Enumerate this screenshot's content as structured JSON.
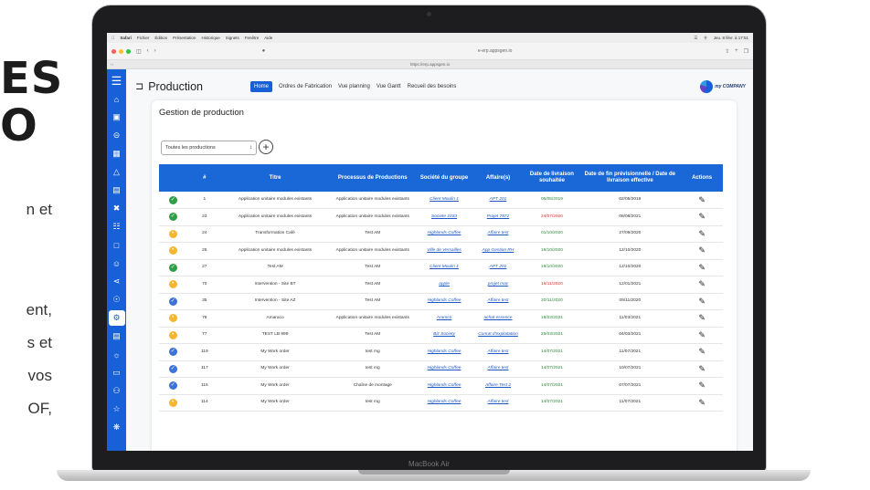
{
  "hero": {
    "line1": "ES",
    "line2": "O",
    "frag1": "n  et",
    "frag2": "ent,",
    "frag3": "s  et",
    "frag4": "vos",
    "frag5": "OF,"
  },
  "laptop_label": "MacBook Air",
  "menubar": {
    "items": [
      "Safari",
      "Fichier",
      "Édition",
      "Présentation",
      "Historique",
      "Signets",
      "Fenêtre",
      "Aide"
    ],
    "clock": "Jeu. 8 févr. à 17:51"
  },
  "browser": {
    "address": "e-erp.appsgen.io",
    "tab_url": "https://erp.appsgen.io"
  },
  "app": {
    "page_title": "Production",
    "nav": [
      "Home",
      "Ordres de Fabrication",
      "Vue planning",
      "Vue Gantt",
      "Recueil des besoins"
    ],
    "logo_text": "my COMPANY",
    "card_title": "Gestion de production",
    "filter_value": "Toutes les productions",
    "columns": [
      "",
      "#",
      "Titre",
      "Processus de Productions",
      "Société du groupe",
      "Affaire(s)",
      "Date de livraison souhaitée",
      "Date de fin prévisionnelle / Date de livraison effective",
      "Actions"
    ],
    "rows": [
      {
        "status": "ok",
        "id": "1",
        "titre": "Application unitaire modules existants",
        "processus": "Application unitaire modules existants",
        "societe": "Client Moulin 1",
        "affaire": "APT 201",
        "date1": "05/05/2019",
        "date1_color": "green",
        "date2": "02/05/2019"
      },
      {
        "status": "ok",
        "id": "23",
        "titre": "Application unitaire modules existants",
        "processus": "Application unitaire modules existants",
        "societe": "Societe 1033",
        "affaire": "Projet 7872",
        "date1": "24/07/2020",
        "date1_color": "red",
        "date2": "08/08/2021"
      },
      {
        "status": "wait",
        "id": "24",
        "titre": "Transformation Café",
        "processus": "Test AM",
        "societe": "Highlands Coffee",
        "affaire": "Affaire test",
        "date1": "01/10/2020",
        "date1_color": "green",
        "date2": "27/09/2020"
      },
      {
        "status": "wait",
        "id": "26",
        "titre": "Application unitaire modules existants",
        "processus": "Application unitaire modules existants",
        "societe": "Ville de Versailles",
        "affaire": "App Gestion RH",
        "date1": "19/10/2020",
        "date1_color": "green",
        "date2": "12/10/2020"
      },
      {
        "status": "ok",
        "id": "27",
        "titre": "Test AM",
        "processus": "Test AM",
        "societe": "Client Moulin 1",
        "affaire": "APT 201",
        "date1": "19/10/2020",
        "date1_color": "green",
        "date2": "12/10/2020"
      },
      {
        "status": "wait",
        "id": "70",
        "titre": "Intervention - Site BT",
        "processus": "Test AM",
        "societe": "apple",
        "affaire": "projet mac",
        "date1": "16/11/2020",
        "date1_color": "red",
        "date2": "12/01/2021"
      },
      {
        "status": "prog",
        "id": "35",
        "titre": "Intervention - Site AZ",
        "processus": "Test AM",
        "societe": "Highlands Coffee",
        "affaire": "Affaire test",
        "date1": "20/11/2020",
        "date1_color": "green",
        "date2": "09/11/2020"
      },
      {
        "status": "wait",
        "id": "78",
        "titre": "Amaraco",
        "processus": "Application unitaire modules existants",
        "societe": "Aramco",
        "affaire": "achat essence",
        "date1": "18/03/2021",
        "date1_color": "green",
        "date2": "11/03/2021"
      },
      {
        "status": "wait",
        "id": "77",
        "titre": "TEST LB 999",
        "processus": "Test AM",
        "societe": "Biz Society",
        "affaire": "Conrat d'exploitation",
        "date1": "25/03/2021",
        "date1_color": "green",
        "date2": "04/03/2021"
      },
      {
        "status": "prog",
        "id": "119",
        "titre": "My Work order",
        "processus": "test mg",
        "societe": "Highlands Coffee",
        "affaire": "Affaire test",
        "date1": "14/07/2021",
        "date1_color": "green",
        "date2": "11/07/2021"
      },
      {
        "status": "prog",
        "id": "117",
        "titre": "My Work order",
        "processus": "test mg",
        "societe": "Highlands Coffee",
        "affaire": "Affaire test",
        "date1": "14/07/2021",
        "date1_color": "green",
        "date2": "10/07/2021"
      },
      {
        "status": "prog",
        "id": "116",
        "titre": "My Work order",
        "processus": "Chaîne de montage",
        "societe": "Highlands Coffee",
        "affaire": "Affaire Test 2",
        "date1": "14/07/2021",
        "date1_color": "green",
        "date2": "07/07/2021"
      },
      {
        "status": "wait",
        "id": "114",
        "titre": "My Work order",
        "processus": "test mg",
        "societe": "Highlands Coffee",
        "affaire": "Affaire test",
        "date1": "14/07/2021",
        "date1_color": "green",
        "date2": "11/07/2021"
      }
    ]
  },
  "colors": {
    "accent": "#1760d8",
    "ok": "#2f9e44",
    "wait": "#f5b731",
    "prog": "#3b73d6",
    "late": "#d0342c"
  }
}
